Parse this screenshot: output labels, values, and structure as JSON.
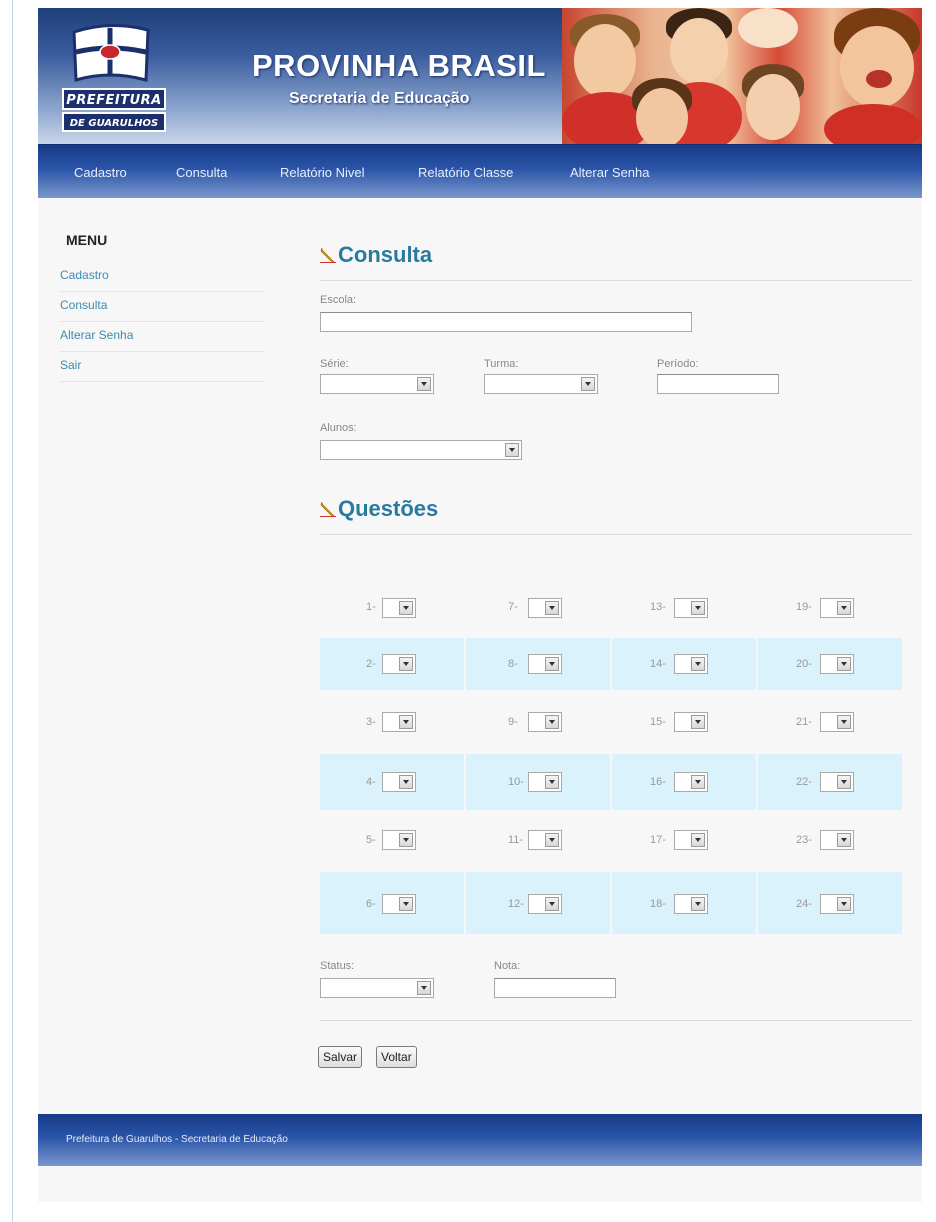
{
  "header": {
    "logo_line1": "PREFEITURA",
    "logo_line2": "DE GUARULHOS",
    "title": "PROVINHA BRASIL",
    "subtitle": "Secretaria de Educação"
  },
  "nav": {
    "items": [
      "Cadastro",
      "Consulta",
      "Relatório Nivel",
      "Relatório Classe",
      "Alterar Senha"
    ]
  },
  "sidebar": {
    "title": "MENU",
    "items": [
      "Cadastro",
      "Consulta",
      "Alterar Senha",
      "Sair"
    ]
  },
  "consulta": {
    "title": "Consulta",
    "escola_label": "Escola:",
    "serie_label": "Série:",
    "turma_label": "Turma:",
    "periodo_label": "Período:",
    "alunos_label": "Alunos:"
  },
  "questoes": {
    "title": "Questões",
    "rows": [
      [
        "1-",
        "7-",
        "13-",
        "19-"
      ],
      [
        "2-",
        "8-",
        "14-",
        "20-"
      ],
      [
        "3-",
        "9-",
        "15-",
        "21-"
      ],
      [
        "4-",
        "10-",
        "16-",
        "22-"
      ],
      [
        "5-",
        "11-",
        "17-",
        "23-"
      ],
      [
        "6-",
        "12-",
        "18-",
        "24-"
      ]
    ]
  },
  "resultado": {
    "status_label": "Status:",
    "nota_label": "Nota:"
  },
  "buttons": {
    "save": "Salvar",
    "back": "Voltar"
  },
  "footer": {
    "text": "Prefeitura de Guarulhos - Secretaria de Educação"
  },
  "colors": {
    "nav_blue": "#2a55a8",
    "title_teal": "#2a7aa0",
    "link_blue": "#3d8bb1",
    "alt_row": "#d9f2fb"
  }
}
